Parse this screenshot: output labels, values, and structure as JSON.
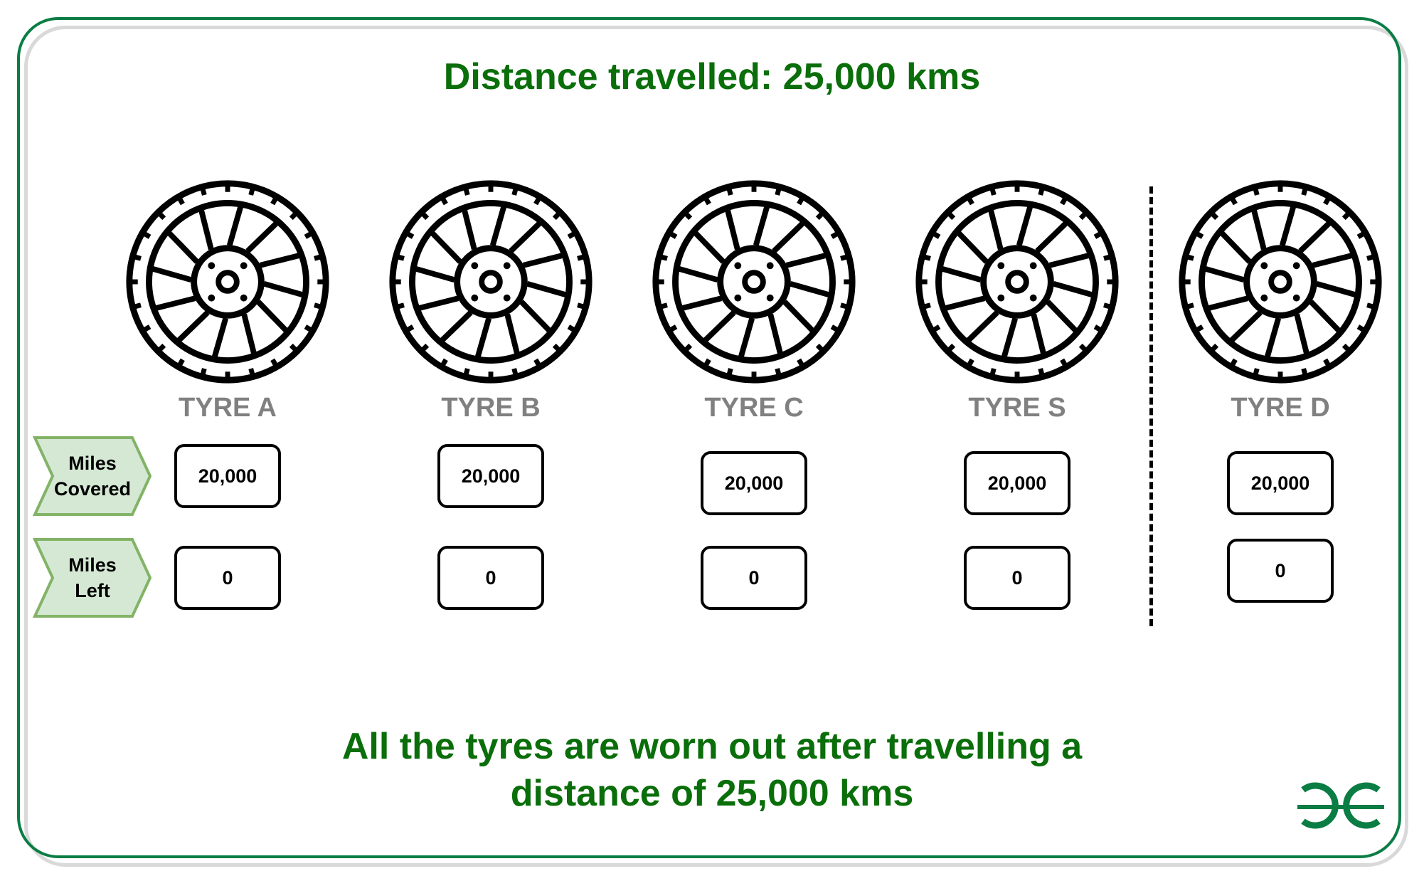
{
  "title": "Distance travelled: 25,000 kms",
  "row_labels": {
    "covered": [
      "Miles",
      "Covered"
    ],
    "left": [
      "Miles",
      "Left"
    ]
  },
  "tyres": [
    {
      "label": "TYRE A",
      "covered": "20,000",
      "left": "0"
    },
    {
      "label": "TYRE B",
      "covered": "20,000",
      "left": "0"
    },
    {
      "label": "TYRE C",
      "covered": "20,000",
      "left": "0"
    },
    {
      "label": "TYRE S",
      "covered": "20,000",
      "left": "0"
    },
    {
      "label": "TYRE D",
      "covered": "20,000",
      "left": "0"
    }
  ],
  "footer": {
    "line1": "All the tyres are worn out after travelling a",
    "line2": "distance of 25,000 kms"
  },
  "colors": {
    "title_green": "#0a6e0a",
    "frame_green": "#0a7d44",
    "label_gray": "#808080",
    "tag_fill": "#d5e8d4",
    "tag_stroke": "#82b366"
  },
  "logo": "geeksforgeeks-logo"
}
